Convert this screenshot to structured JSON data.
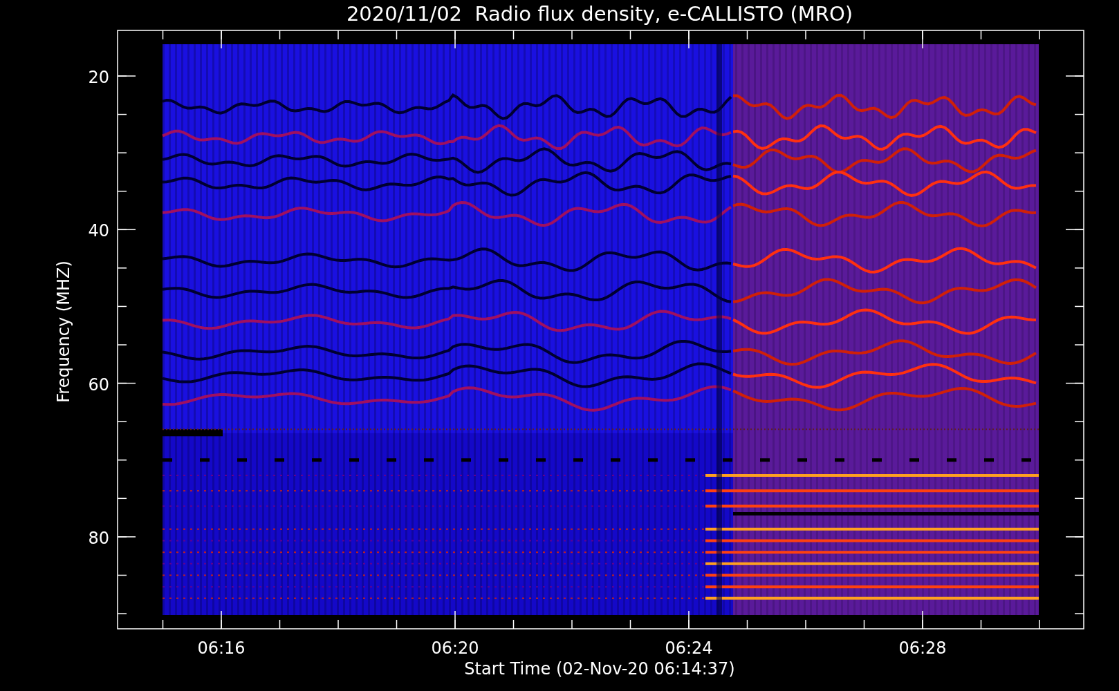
{
  "title": "2020/11/02  Radio flux density, e-CALLISTO (MRO)",
  "x_axis": {
    "label": "Start Time (02-Nov-20 06:14:37)",
    "ticks": [
      "06:16",
      "06:20",
      "06:24",
      "06:28"
    ]
  },
  "y_axis": {
    "label": "Frequency (MHZ)",
    "ticks": [
      "20",
      "40",
      "60",
      "80"
    ]
  }
}
